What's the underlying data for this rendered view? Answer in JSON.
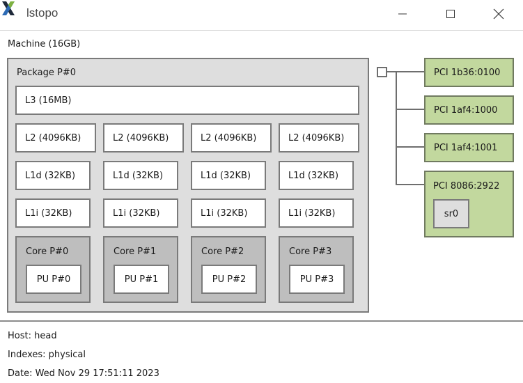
{
  "window": {
    "title": "lstopo",
    "icon": "lstopo-x-icon"
  },
  "machine": {
    "label": "Machine (16GB)",
    "package": {
      "label": "Package P#0",
      "l3": "L3 (16MB)",
      "l2": [
        "L2 (4096KB)",
        "L2 (4096KB)",
        "L2 (4096KB)",
        "L2 (4096KB)"
      ],
      "l1d": [
        "L1d (32KB)",
        "L1d (32KB)",
        "L1d (32KB)",
        "L1d (32KB)"
      ],
      "l1i": [
        "L1i (32KB)",
        "L1i (32KB)",
        "L1i (32KB)",
        "L1i (32KB)"
      ],
      "cores": [
        {
          "label": "Core P#0",
          "pu": "PU P#0"
        },
        {
          "label": "Core P#1",
          "pu": "PU P#1"
        },
        {
          "label": "Core P#2",
          "pu": "PU P#2"
        },
        {
          "label": "Core P#3",
          "pu": "PU P#3"
        }
      ]
    },
    "pci": [
      {
        "label": "PCI 1b36:0100"
      },
      {
        "label": "PCI 1af4:1000"
      },
      {
        "label": "PCI 1af4:1001"
      },
      {
        "label": "PCI 8086:2922",
        "child": "sr0"
      }
    ]
  },
  "footer": {
    "host": "Host: head",
    "indexes": "Indexes: physical",
    "date": "Date: Wed Nov 29 17:51:11 2023"
  },
  "colors": {
    "pci_fill": "#c2d89e",
    "core_fill": "#bebebe",
    "package_fill": "#dedede",
    "cache_fill": "#ffffff"
  }
}
